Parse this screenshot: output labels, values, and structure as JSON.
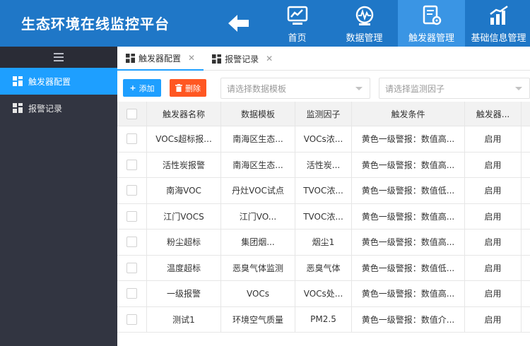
{
  "header": {
    "title": "生态环境在线监控平台",
    "nav": [
      {
        "label": "首页",
        "icon": "chart-monitor-icon"
      },
      {
        "label": "数据管理",
        "icon": "gauge-icon"
      },
      {
        "label": "触发器管理",
        "icon": "settings-document-icon",
        "active": true
      },
      {
        "label": "基础信息管理",
        "icon": "bar-chart-icon"
      }
    ]
  },
  "sidebar": {
    "items": [
      {
        "label": "触发器配置",
        "active": true
      },
      {
        "label": "报警记录",
        "active": false
      }
    ]
  },
  "tabs": [
    {
      "label": "触发器配置",
      "active": true
    },
    {
      "label": "报警记录",
      "active": false
    }
  ],
  "toolbar": {
    "add_label": "添加",
    "delete_label": "删除",
    "template_placeholder": "请选择数据模板",
    "factor_placeholder": "请选择监测因子"
  },
  "table": {
    "headers": [
      "触发器名称",
      "数据模板",
      "监测因子",
      "触发条件",
      "触发器..."
    ],
    "rows": [
      [
        "VOCs超标报...",
        "南海区生态...",
        "VOCs浓...",
        "黄色一级警报：数值高...",
        "启用"
      ],
      [
        "活性炭报警",
        "南海区生态...",
        "活性炭...",
        "黄色一级警报：数值高...",
        "启用"
      ],
      [
        "南海VOC",
        "丹灶VOC试点",
        "TVOC浓...",
        "黄色一级警报：数值低...",
        "启用"
      ],
      [
        "江门VOCS",
        "江门VO...",
        "TVOC浓...",
        "黄色一级警报：数值高...",
        "启用"
      ],
      [
        "粉尘超标",
        "集团烟...",
        "烟尘1",
        "黄色一级警报：数值高...",
        "启用"
      ],
      [
        "温度超标",
        "恶臭气体监测",
        "恶臭气体",
        "黄色一级警报：数值低...",
        "启用"
      ],
      [
        "一级报警",
        "VOCs",
        "VOCs处...",
        "黄色一级警报：数值高...",
        "启用"
      ],
      [
        "测试1",
        "环境空气质量",
        "PM2.5",
        "黄色一级警报：数值介...",
        "启用"
      ]
    ]
  },
  "colors": {
    "header_bg": "#1f77c7",
    "nav_active": "#3a95e4",
    "sidebar_bg": "#323541",
    "primary": "#1e9fff",
    "danger": "#ff5722"
  }
}
